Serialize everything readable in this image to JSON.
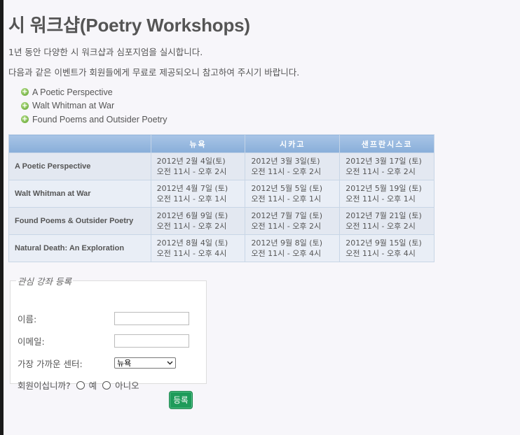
{
  "title": "시 워크샵(Poetry Workshops)",
  "intro": [
    "1년 동안 다양한 시 워크샵과 심포지엄을 실시합니다.",
    "다음과 같은 이벤트가 회원들에게 무료로 제공되오니 참고하여 주시기 바랍니다."
  ],
  "event_list": [
    "A Poetic Perspective",
    "Walt Whitman at War",
    "Found Poems and Outsider Poetry"
  ],
  "bullet_glyph": "+",
  "schedule": {
    "headers": [
      "",
      "뉴욕",
      "시카고",
      "샌프란시스코"
    ],
    "rows": [
      {
        "event": "A Poetic Perspective",
        "cells": [
          [
            "2012년 2월 4일(토)",
            "오전 11시 - 오후 2시"
          ],
          [
            "2012년 3월 3일(토)",
            "오전 11시 - 오후 2시"
          ],
          [
            "2012년 3월 17일 (토)",
            "오전 11시 - 오후 2시"
          ]
        ]
      },
      {
        "event": "Walt Whitman at War",
        "cells": [
          [
            "2012년 4월 7일 (토)",
            "오전 11시 - 오후 1시"
          ],
          [
            "2012년 5월 5일 (토)",
            "오전 11시 - 오후 1시"
          ],
          [
            "2012년 5월 19일 (토)",
            "오전 11시 - 오후 1시"
          ]
        ]
      },
      {
        "event": "Found Poems & Outsider Poetry",
        "cells": [
          [
            "2012년 6월 9일 (토)",
            "오전 11시 - 오후 2시"
          ],
          [
            "2012년 7월 7일 (토)",
            "오전 11시 - 오후 2시"
          ],
          [
            "2012년 7월 21일 (토)",
            "오전 11시 - 오후 2시"
          ]
        ]
      },
      {
        "event": "Natural Death: An Exploration",
        "cells": [
          [
            "2012년 8월 4일 (토)",
            "오전 11시 - 오후 4시"
          ],
          [
            "2012년 9월 8일 (토)",
            "오전 11시 - 오후 4시"
          ],
          [
            "2012년 9월 15일 (토)",
            "오전 11시 - 오후 4시"
          ]
        ]
      }
    ]
  },
  "form": {
    "legend": "관심 강좌 등록",
    "name_label": "이름:",
    "name_value": "",
    "email_label": "이메일:",
    "email_value": "",
    "center_label": "가장 가까운 센터:",
    "center_selected": "뉴욕",
    "member_label": "회원이십니까?",
    "member_yes": "예",
    "member_no": "아니오",
    "submit_label": "등록"
  },
  "colors": {
    "header_bg": "#99b8df",
    "submit_bg": "#1e9b5a",
    "bullet": "#6fb03a"
  }
}
